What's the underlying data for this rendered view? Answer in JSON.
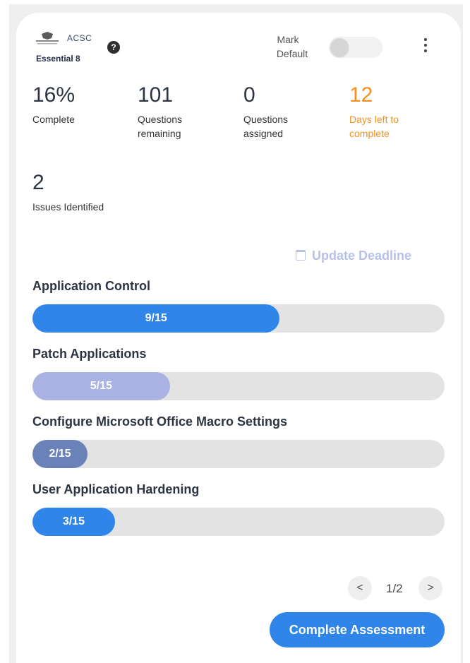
{
  "header": {
    "logo_text": "Essential 8",
    "logo_agency": "ACSC",
    "help_icon": "question-icon",
    "mark_default_label": [
      "Mark",
      "Default"
    ],
    "mark_default_on": false,
    "menu_icon": "more-vertical-icon"
  },
  "stats": [
    {
      "value": "16%",
      "label": [
        "Complete"
      ]
    },
    {
      "value": "101",
      "label": [
        "Questions",
        "remaining"
      ]
    },
    {
      "value": "0",
      "label": [
        "Questions",
        "assigned"
      ]
    },
    {
      "value": "12",
      "label": [
        "Days left to",
        "complete"
      ],
      "color": "#f5901e"
    },
    {
      "value": "2",
      "label": [
        "Issues Identified"
      ]
    }
  ],
  "deadline": {
    "label": "Update Deadline",
    "icon": "calendar-icon"
  },
  "controls": [
    {
      "title": "Application Control",
      "progress": "9/15",
      "done": 9,
      "total": 15,
      "color": "#2f86e8"
    },
    {
      "title": "Patch Applications",
      "progress": "5/15",
      "done": 5,
      "total": 15,
      "color": "#a9b2e3"
    },
    {
      "title": "Configure Microsoft Office Macro Settings",
      "progress": "2/15",
      "done": 2,
      "total": 15,
      "color": "#6a82b8"
    },
    {
      "title": "User Application Hardening",
      "progress": "3/15",
      "done": 3,
      "total": 15,
      "color": "#2f86e8"
    }
  ],
  "pager": {
    "prev": "<",
    "label": "1/2",
    "next": ">"
  },
  "complete_button": "Complete Assessment"
}
